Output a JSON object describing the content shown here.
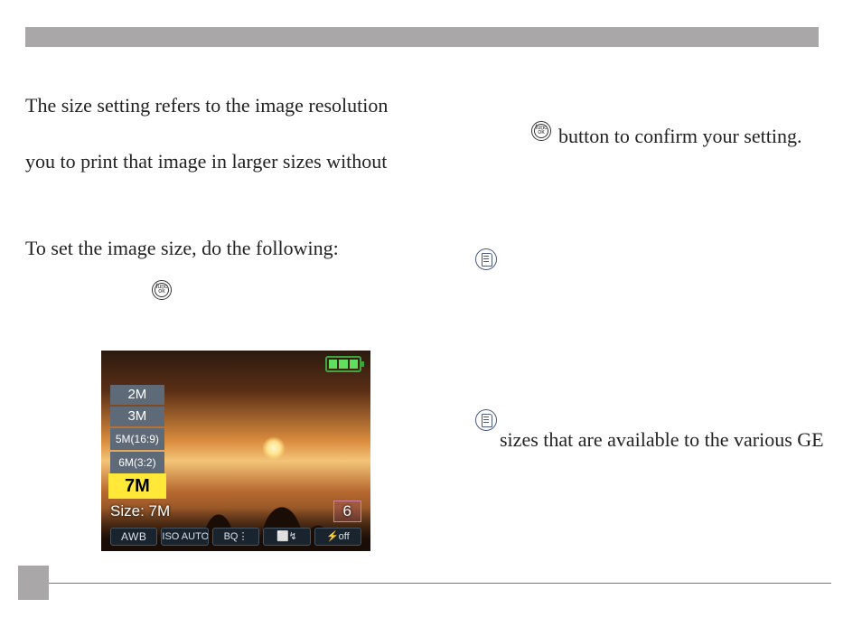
{
  "text": {
    "p1": "The size setting refers to the image resolution",
    "p2": "you to print that image in larger sizes without",
    "p3": "To set the image size, do the following:",
    "right1": " button to confirm your setting.",
    "right2": "sizes that are available to the various GE"
  },
  "icons": {
    "func_top": "func",
    "func_bottom": "ok"
  },
  "camera": {
    "menu": [
      "2M",
      "3M",
      "5M(16:9)",
      "6M(3:2)",
      "7M"
    ],
    "selected_index": 4,
    "size_label": "Size: 7M",
    "count": "6",
    "toolbar": [
      "AWB",
      "ISO AUTO",
      "BQ⋮",
      "⬜↯",
      "⚡off"
    ]
  }
}
